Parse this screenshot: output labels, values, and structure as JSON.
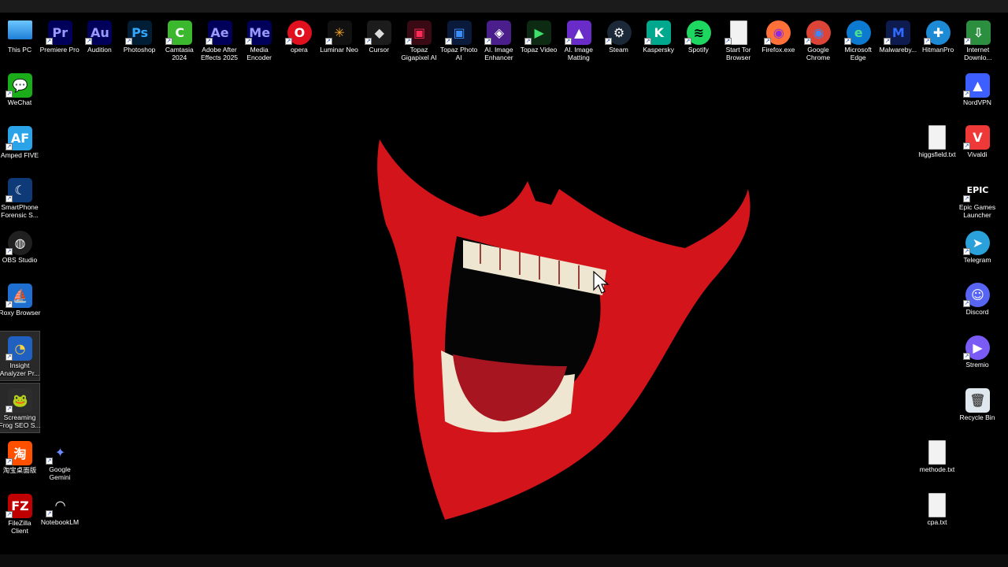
{
  "desktop": {
    "top_row": [
      {
        "label": "This PC",
        "icon": "monitor-icon",
        "text": "",
        "color": "#3aa0e8"
      },
      {
        "label": "Premiere Pro",
        "icon": "premiere-pro-icon",
        "text": "Pr",
        "color": "#00005b",
        "fg": "#9999ff"
      },
      {
        "label": "Audition",
        "icon": "audition-icon",
        "text": "Au",
        "color": "#00005b",
        "fg": "#9999ff"
      },
      {
        "label": "Photoshop",
        "icon": "photoshop-icon",
        "text": "Ps",
        "color": "#001e36",
        "fg": "#31a8ff"
      },
      {
        "label": "Camtasia\n2024",
        "icon": "camtasia-icon",
        "text": "C",
        "color": "#3cb82e",
        "fg": "#ffffff"
      },
      {
        "label": "Adobe After\nEffects 2025",
        "icon": "after-effects-icon",
        "text": "Ae",
        "color": "#00005b",
        "fg": "#9999ff"
      },
      {
        "label": "Media\nEncoder",
        "icon": "media-encoder-icon",
        "text": "Me",
        "color": "#00005b",
        "fg": "#9999ff"
      },
      {
        "label": "opera",
        "icon": "opera-icon",
        "text": "O",
        "color": "#e0101e",
        "fg": "#ffffff"
      },
      {
        "label": "Luminar Neo",
        "icon": "luminar-neo-icon",
        "text": "✳",
        "color": "#111111",
        "fg": "#f5a623"
      },
      {
        "label": "Cursor",
        "icon": "cursor-app-icon",
        "text": "◆",
        "color": "#1c1c1c",
        "fg": "#dcdcdc"
      },
      {
        "label": "Topaz\nGigapixel AI",
        "icon": "topaz-gigapixel-icon",
        "text": "▣",
        "color": "#3a0a14",
        "fg": "#ff2a55"
      },
      {
        "label": "Topaz Photo\nAI",
        "icon": "topaz-photo-icon",
        "text": "▣",
        "color": "#0a1a3a",
        "fg": "#3a8dff"
      },
      {
        "label": "AI. Image\nEnhancer",
        "icon": "ai-image-enhancer-icon",
        "text": "◈",
        "color": "#4a1f8c",
        "fg": "#ffffff"
      },
      {
        "label": "Topaz Video",
        "icon": "topaz-video-icon",
        "text": "▶",
        "color": "#0d2a12",
        "fg": "#3ee06a"
      },
      {
        "label": "AI. Image\nMatting",
        "icon": "ai-image-matting-icon",
        "text": "▲",
        "color": "#6a2cc8",
        "fg": "#ffffff"
      },
      {
        "label": "Steam",
        "icon": "steam-icon",
        "text": "⚙",
        "color": "#1b2838",
        "fg": "#ffffff"
      },
      {
        "label": "Kaspersky",
        "icon": "kaspersky-icon",
        "text": "K",
        "color": "#00a88e",
        "fg": "#ffffff"
      },
      {
        "label": "Spotify",
        "icon": "spotify-icon",
        "text": "≋",
        "color": "#1ed760",
        "fg": "#000000"
      },
      {
        "label": "Start Tor\nBrowser",
        "icon": "file-icon",
        "text": "",
        "color": "#f2f2f2",
        "fg": "#999999"
      },
      {
        "label": "Firefox.exe",
        "icon": "firefox-icon",
        "text": "◉",
        "color": "#ff7139",
        "fg": "#8a2be2"
      },
      {
        "label": "Google\nChrome",
        "icon": "chrome-icon",
        "text": "◉",
        "color": "#db4437",
        "fg": "#4285f4"
      },
      {
        "label": "Microsoft\nEdge",
        "icon": "edge-icon",
        "text": "e",
        "color": "#0c7ad1",
        "fg": "#4ee08c"
      },
      {
        "label": "Malwareby...",
        "icon": "malwarebytes-icon",
        "text": "M",
        "color": "#0d1b4f",
        "fg": "#2f6bff"
      },
      {
        "label": "HitmanPro",
        "icon": "hitmanpro-icon",
        "text": "✚",
        "color": "#1d8ad6",
        "fg": "#ffffff"
      },
      {
        "label": "Internet\nDownlo...",
        "icon": "internet-download-manager-icon",
        "text": "⇩",
        "color": "#2c8f3f",
        "fg": "#ffffff"
      }
    ],
    "left_column": [
      {
        "label": "WeChat",
        "icon": "wechat-icon",
        "text": "💬",
        "color": "#1aad19",
        "fg": "#ffffff"
      },
      {
        "label": "Amped FIVE",
        "icon": "amped-five-icon",
        "text": "AF",
        "color": "#2aa3e8",
        "fg": "#ffffff"
      },
      {
        "label": "SmartPhone\nForensic S...",
        "icon": "smartphone-forensic-icon",
        "text": "☾",
        "color": "#0e3b78",
        "fg": "#ffffff"
      },
      {
        "label": "OBS Studio",
        "icon": "obs-studio-icon",
        "text": "◍",
        "color": "#202020",
        "fg": "#ffffff"
      },
      {
        "label": "Roxy Browser",
        "icon": "roxy-browser-icon",
        "text": "⛵",
        "color": "#1f6fd0",
        "fg": "#ffffff"
      },
      {
        "label": "Insight\nAnalyzer Pr...",
        "icon": "insight-analyzer-icon",
        "text": "◔",
        "color": "#2060c0",
        "fg": "#ffd23c"
      },
      {
        "label": "Screaming\nFrog SEO S...",
        "icon": "screaming-frog-icon",
        "text": "🐸",
        "color": "#2d2d2d",
        "fg": "#8bc34a"
      },
      {
        "label": "淘宝桌面版",
        "icon": "taobao-icon",
        "text": "淘",
        "color": "#ff5000",
        "fg": "#ffffff"
      },
      {
        "label": "FileZilla\nClient",
        "icon": "filezilla-icon",
        "text": "FZ",
        "color": "#bf0000",
        "fg": "#ffffff"
      }
    ],
    "second_column": [
      {
        "label": "Google\nGemini",
        "icon": "gemini-icon",
        "text": "✦",
        "color": "#000000",
        "fg": "#6b8cff"
      },
      {
        "label": "NotebookLM",
        "icon": "notebooklm-icon",
        "text": "◠",
        "color": "#000000",
        "fg": "#ffffff"
      }
    ],
    "right_column": [
      {
        "label": "NordVPN",
        "icon": "nordvpn-icon",
        "text": "▲",
        "color": "#3e5fff",
        "fg": "#ffffff"
      },
      {
        "label": "higgsfield.txt",
        "icon": "text-file-icon",
        "text": "",
        "color": "#f2f2f2",
        "fg": "#999999"
      },
      {
        "label": "Vivaldi",
        "icon": "vivaldi-icon",
        "text": "V",
        "color": "#ef3939",
        "fg": "#ffffff"
      },
      {
        "label": "Epic Games\nLauncher",
        "icon": "epic-games-icon",
        "text": "EPIC",
        "color": "#000000",
        "fg": "#ffffff"
      },
      {
        "label": "Telegram",
        "icon": "telegram-icon",
        "text": "➤",
        "color": "#2aa1da",
        "fg": "#ffffff"
      },
      {
        "label": "Discord",
        "icon": "discord-icon",
        "text": "☺",
        "color": "#5865f2",
        "fg": "#ffffff"
      },
      {
        "label": "Stremio",
        "icon": "stremio-icon",
        "text": "▶",
        "color": "#7b5bf5",
        "fg": "#ffffff"
      },
      {
        "label": "Recycle Bin",
        "icon": "recycle-bin-icon",
        "text": "🗑",
        "color": "#dfe8ee",
        "fg": "#555555"
      },
      {
        "label": "methode.txt",
        "icon": "text-file-icon",
        "text": "",
        "color": "#f2f2f2",
        "fg": "#999999"
      },
      {
        "label": "cpa.txt",
        "icon": "text-file-icon",
        "text": "",
        "color": "#f2f2f2",
        "fg": "#999999"
      }
    ]
  }
}
